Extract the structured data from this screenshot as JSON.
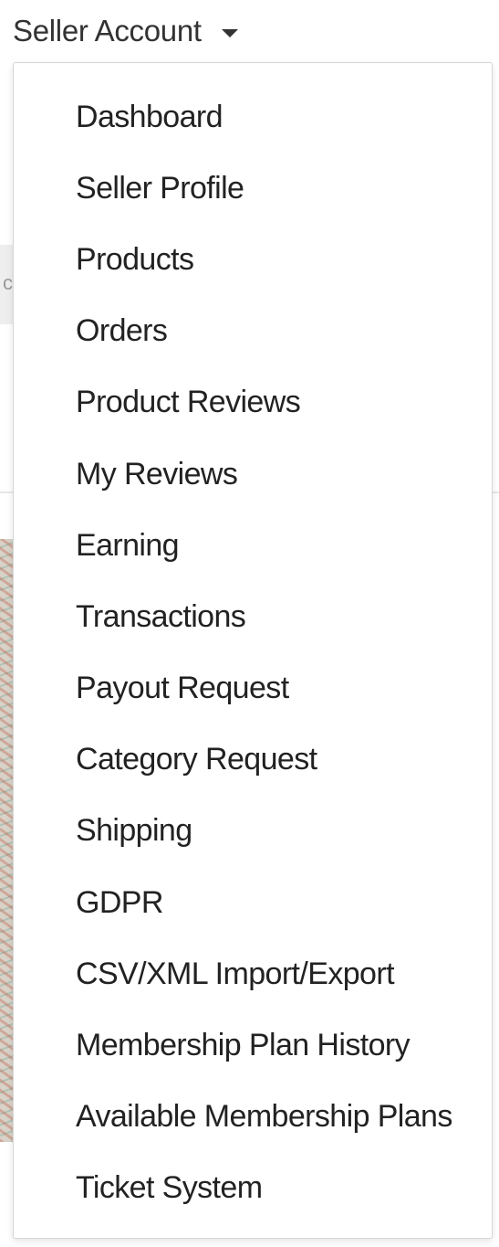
{
  "header": {
    "account_label": "Seller Account"
  },
  "menu": {
    "items": [
      {
        "label": "Dashboard"
      },
      {
        "label": "Seller Profile"
      },
      {
        "label": "Products"
      },
      {
        "label": "Orders"
      },
      {
        "label": "Product Reviews"
      },
      {
        "label": "My Reviews"
      },
      {
        "label": "Earning"
      },
      {
        "label": "Transactions"
      },
      {
        "label": "Payout Request"
      },
      {
        "label": "Category Request"
      },
      {
        "label": "Shipping"
      },
      {
        "label": "GDPR"
      },
      {
        "label": "CSV/XML Import/Export"
      },
      {
        "label": "Membership Plan History"
      },
      {
        "label": "Available Membership Plans"
      },
      {
        "label": "Ticket System"
      }
    ]
  },
  "icons": {
    "toggle_caret": "chevron-down-icon"
  },
  "colors": {
    "text": "#222222",
    "panel_border": "#d6d6d6",
    "background": "#ffffff"
  }
}
